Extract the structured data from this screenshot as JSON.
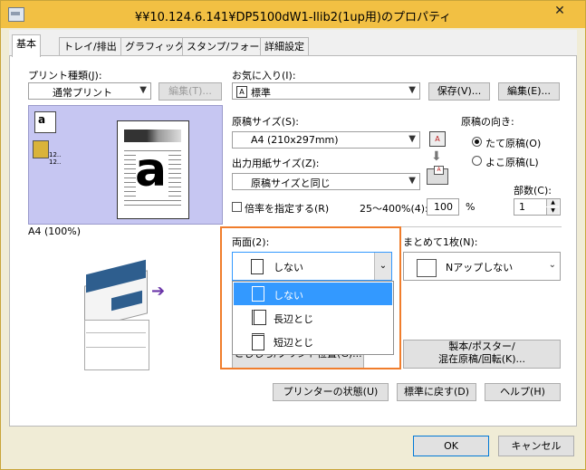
{
  "window": {
    "title": "¥¥10.124.6.141¥DP5100dW1-Ilib2(1up用)のプロパティ",
    "close": "✕"
  },
  "tabs": [
    "基本",
    "トレイ/排出",
    "グラフィックス",
    "スタンプ/フォーム",
    "詳細設定"
  ],
  "left": {
    "print_type_label": "プリント種類(J):",
    "print_type_value": "通常プリント",
    "edit_label": "編集(T)...",
    "preview_caption": "A4 (100%)",
    "preview_letter": "a"
  },
  "favorites": {
    "label": "お気に入り(I):",
    "value": "標準",
    "save_label": "保存(V)...",
    "edit_label": "編集(E)..."
  },
  "paper": {
    "size_label": "原稿サイズ(S):",
    "size_value": "A4 (210x297mm)",
    "output_label": "出力用紙サイズ(Z):",
    "output_value": "原稿サイズと同じ",
    "scale_label": "倍率を指定する(R)",
    "scale_range": "25～400%(4):",
    "scale_value": "100",
    "scale_unit": "%"
  },
  "orientation": {
    "label": "原稿の向き:",
    "portrait": "たて原稿(O)",
    "landscape": "よこ原稿(L)",
    "selected": "portrait"
  },
  "copies": {
    "label": "部数(C):",
    "value": "1"
  },
  "duplex": {
    "label": "両面(2):",
    "value": "しない",
    "options": [
      "しない",
      "長辺とじ",
      "短辺とじ"
    ],
    "selected_index": 0
  },
  "nup": {
    "label": "まとめて1枚(N):",
    "value": "Nアップしない"
  },
  "buttons": {
    "position_label": "とじしろ/プリント位置(G)...",
    "booklet_label_1": "製本/ポスター/",
    "booklet_label_2": "混在原稿/回転(K)...",
    "printer_status": "プリンターの状態(U)",
    "restore_defaults": "標準に戻す(D)",
    "help": "ヘルプ(H)",
    "ok": "OK",
    "cancel": "キャンセル"
  },
  "colors": {
    "titlebar": "#f2c043",
    "highlight": "#3399ff",
    "callout": "#f07d2c",
    "printer_blue": "#2e5e8e"
  }
}
